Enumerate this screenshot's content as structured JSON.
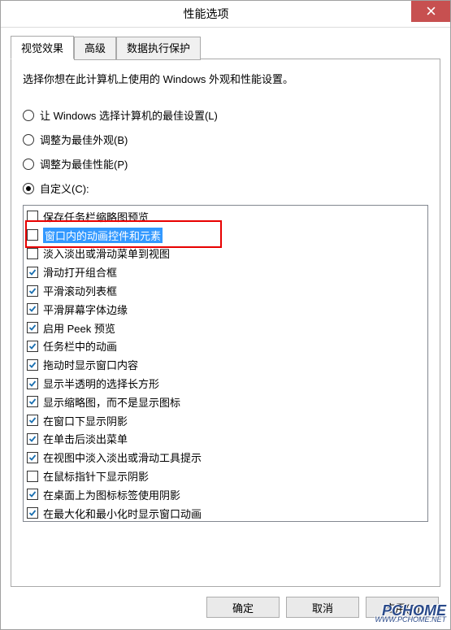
{
  "window": {
    "title": "性能选项"
  },
  "tabs": [
    {
      "label": "视觉效果",
      "active": true
    },
    {
      "label": "高级",
      "active": false
    },
    {
      "label": "数据执行保护",
      "active": false
    }
  ],
  "description": "选择你想在此计算机上使用的 Windows 外观和性能设置。",
  "radios": [
    {
      "label": "让 Windows 选择计算机的最佳设置(L)",
      "checked": false
    },
    {
      "label": "调整为最佳外观(B)",
      "checked": false
    },
    {
      "label": "调整为最佳性能(P)",
      "checked": false
    },
    {
      "label": "自定义(C):",
      "checked": true
    }
  ],
  "checks": [
    {
      "label": "保存任务栏缩略图预览",
      "checked": false,
      "selected": false
    },
    {
      "label": "窗口内的动画控件和元素",
      "checked": false,
      "selected": true
    },
    {
      "label": "淡入淡出或滑动菜单到视图",
      "checked": false,
      "selected": false
    },
    {
      "label": "滑动打开组合框",
      "checked": true,
      "selected": false
    },
    {
      "label": "平滑滚动列表框",
      "checked": true,
      "selected": false
    },
    {
      "label": "平滑屏幕字体边缘",
      "checked": true,
      "selected": false
    },
    {
      "label": "启用 Peek 预览",
      "checked": true,
      "selected": false
    },
    {
      "label": "任务栏中的动画",
      "checked": true,
      "selected": false
    },
    {
      "label": "拖动时显示窗口内容",
      "checked": true,
      "selected": false
    },
    {
      "label": "显示半透明的选择长方形",
      "checked": true,
      "selected": false
    },
    {
      "label": "显示缩略图，而不是显示图标",
      "checked": true,
      "selected": false
    },
    {
      "label": "在窗口下显示阴影",
      "checked": true,
      "selected": false
    },
    {
      "label": "在单击后淡出菜单",
      "checked": true,
      "selected": false
    },
    {
      "label": "在视图中淡入淡出或滑动工具提示",
      "checked": true,
      "selected": false
    },
    {
      "label": "在鼠标指针下显示阴影",
      "checked": false,
      "selected": false
    },
    {
      "label": "在桌面上为图标标签使用阴影",
      "checked": true,
      "selected": false
    },
    {
      "label": "在最大化和最小化时显示窗口动画",
      "checked": true,
      "selected": false
    }
  ],
  "buttons": {
    "ok": "确定",
    "cancel": "取消",
    "apply": "应用(A)"
  },
  "watermark": {
    "line1": "PCHOME",
    "line2": "WWW.PCHOME.NET"
  }
}
